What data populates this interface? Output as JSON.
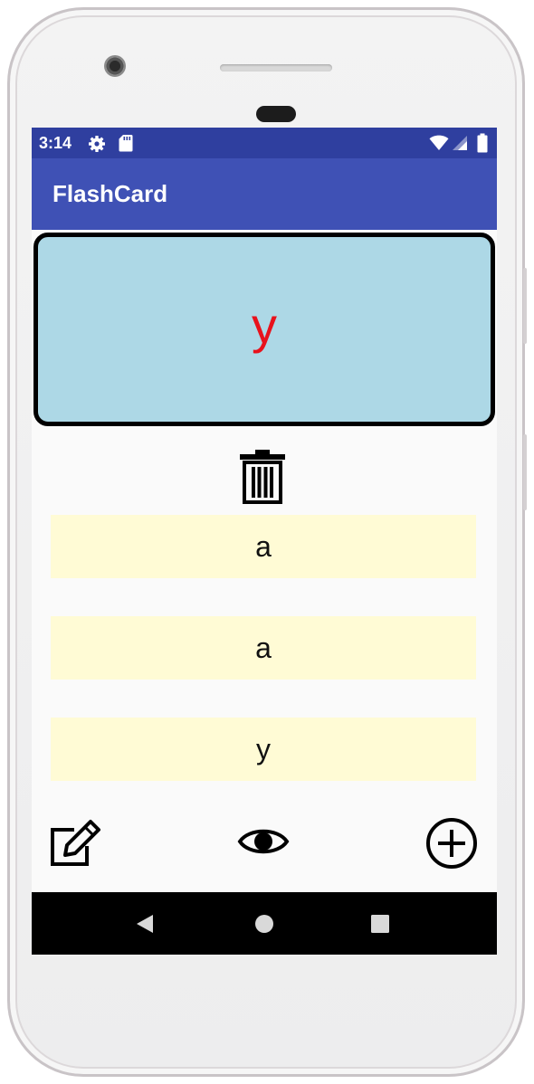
{
  "status_bar": {
    "time": "3:14",
    "icons": [
      "settings-icon",
      "sd-card-icon",
      "wifi-icon",
      "signal-icon",
      "battery-icon"
    ],
    "background": "#2f3f9f"
  },
  "app_bar": {
    "title": "FlashCard",
    "background": "#3f51b5"
  },
  "flashcard": {
    "question": "y",
    "background": "#add8e6",
    "text_color": "#e8121c"
  },
  "delete_icon": "trash-icon",
  "answers": [
    {
      "label": "a"
    },
    {
      "label": "a"
    },
    {
      "label": "y"
    }
  ],
  "answer_background": "#fffbd5",
  "toolbar": {
    "edit_icon": "edit-icon",
    "show_icon": "eye-icon",
    "add_icon": "add-circle-icon"
  },
  "nav": {
    "back_icon": "back-icon",
    "home_icon": "home-icon",
    "recents_icon": "recents-icon"
  }
}
